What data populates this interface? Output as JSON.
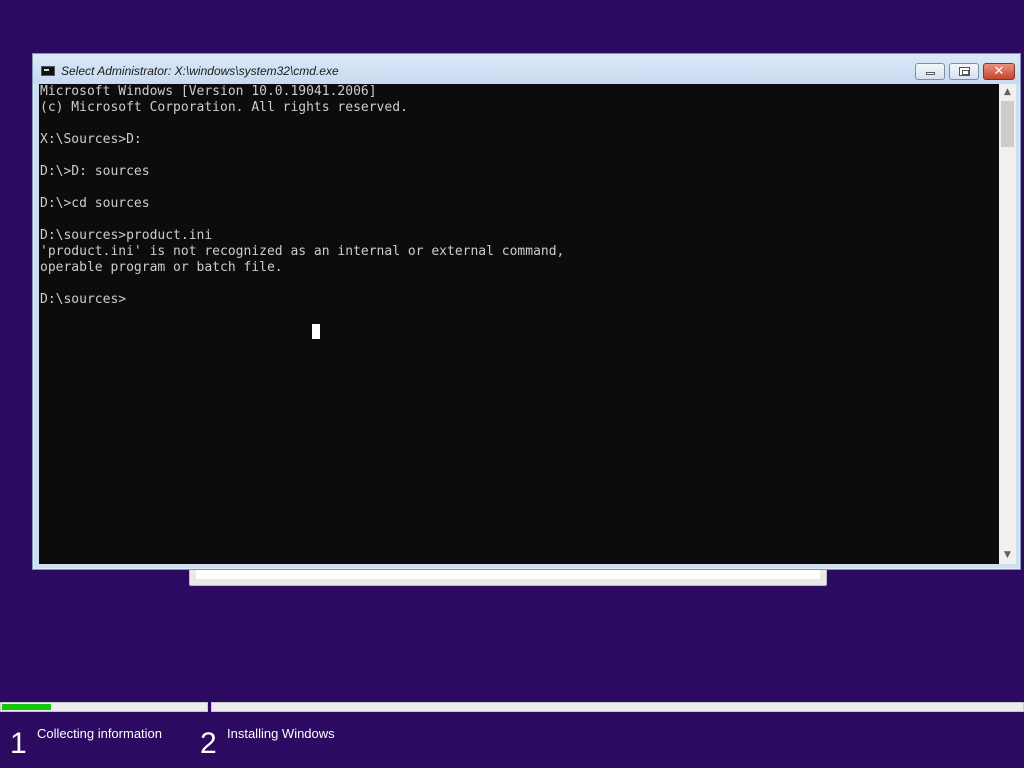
{
  "window": {
    "title": "Select Administrator: X:\\windows\\system32\\cmd.exe",
    "icon": "console-icon",
    "buttons": {
      "minimize": "minimize-icon",
      "maximize": "maximize-icon",
      "close": "close-icon",
      "close_glyph": "✕"
    }
  },
  "console": {
    "lines": [
      "Microsoft Windows [Version 10.0.19041.2006]",
      "(c) Microsoft Corporation. All rights reserved.",
      "",
      "X:\\Sources>D:",
      "",
      "D:\\>D: sources",
      "",
      "D:\\>cd sources",
      "",
      "D:\\sources>product.ini",
      "'product.ini' is not recognized as an internal or external command,",
      "operable program or batch file.",
      "",
      "D:\\sources>"
    ]
  },
  "scrollbar": {
    "up_glyph": "▲",
    "down_glyph": "▼"
  },
  "setup_progress": {
    "steps": [
      {
        "number": "1",
        "label": "Collecting information",
        "progress": 0.24
      },
      {
        "number": "2",
        "label": "Installing Windows",
        "progress": 0
      }
    ]
  },
  "colors": {
    "desktop_background": "#2c0a62",
    "console_background": "#0c0c0c",
    "console_text": "#cccccc",
    "progress_fill": "#16c60c"
  }
}
